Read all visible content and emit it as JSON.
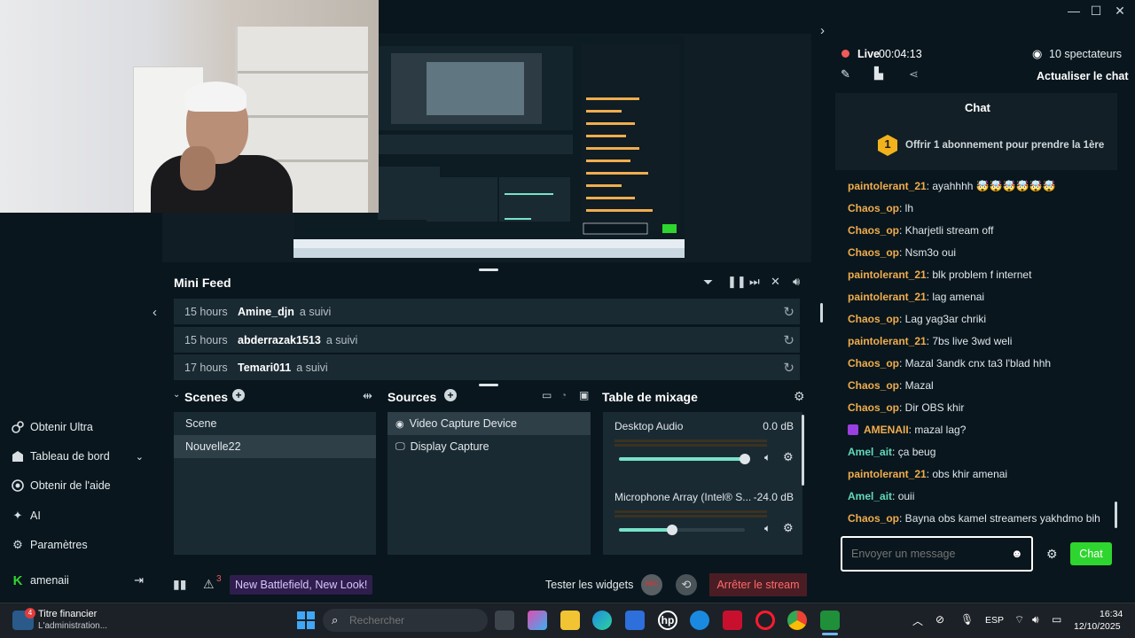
{
  "window": {
    "minimize": "—",
    "maximize": "☐",
    "close": "✕",
    "collapse": "›"
  },
  "colors": {
    "accent": "#80f5d2",
    "live_red": "#f05a5a",
    "chat_button": "#2fd52f",
    "orange_user": "#f0ad4e",
    "green_user": "#63d8b9",
    "badge": "#2f3bd4"
  },
  "nav": {
    "items": [
      {
        "label": "Obtenir Ultra",
        "icon": "ultra-icon"
      },
      {
        "label": "Tableau de bord",
        "icon": "dashboard-icon"
      },
      {
        "label": "Obtenir de l'aide",
        "icon": "help-icon"
      },
      {
        "label": "AI",
        "icon": "sparkle-icon"
      },
      {
        "label": "Paramètres",
        "icon": "gear-icon"
      }
    ],
    "user": "amenaii",
    "collapse_arrow": "‹"
  },
  "minifeed": {
    "title": "Mini Feed",
    "rows": [
      {
        "time": "15 hours",
        "name": "Amine_djn",
        "action": "a suivi"
      },
      {
        "time": "15 hours",
        "name": "abderrazak1513",
        "action": "a suivi"
      },
      {
        "time": "17 hours",
        "name": "Temari011",
        "action": "a suivi"
      }
    ]
  },
  "scenes": {
    "title": "Scenes",
    "items": [
      "Scene",
      "Nouvelle22"
    ],
    "selected": 1
  },
  "sources": {
    "title": "Sources",
    "items": [
      "Video Capture Device",
      "Display Capture"
    ],
    "selected": 0
  },
  "mixer": {
    "title": "Table de mixage",
    "channels": [
      {
        "name": "Desktop Audio",
        "level": "0.0 dB",
        "volume": 1.0
      },
      {
        "name": "Microphone Array (Intel® S...",
        "level": "-24.0 dB",
        "volume": 0.42
      }
    ]
  },
  "bottombar": {
    "alerts_count": "3",
    "promo": "New Battlefield, New Look!",
    "test_widgets": "Tester les widgets",
    "rec": "REC",
    "stop_stream": "Arrêter le stream"
  },
  "live": {
    "label": "Live",
    "timer": "00:04:13",
    "viewers": "10 spectateurs",
    "refresh_chat": "Actualiser le chat"
  },
  "chat": {
    "title": "Chat",
    "sub_badge": "1",
    "sub_offer": "Offrir 1 abonnement pour prendre la 1ère",
    "messages": [
      {
        "user": "paintolerant_21",
        "text": ": ayahhhh 🤯🤯🤯🤯🤯🤯",
        "color": "orange"
      },
      {
        "user": "Chaos_op",
        "text": ": lh",
        "color": "orange"
      },
      {
        "user": "Chaos_op",
        "text": ": Kharjetli stream off",
        "color": "orange"
      },
      {
        "user": "Chaos_op",
        "text": ": Nsm3o oui",
        "color": "orange"
      },
      {
        "user": "paintolerant_21",
        "text": ": blk problem f internet",
        "color": "orange"
      },
      {
        "user": "paintolerant_21",
        "text": ": lag amenai",
        "color": "orange"
      },
      {
        "user": "Chaos_op",
        "text": ": Lag yag3ar chriki",
        "color": "orange"
      },
      {
        "user": "paintolerant_21",
        "text": ": 7bs live 3wd weli",
        "color": "orange"
      },
      {
        "user": "Chaos_op",
        "text": ": Mazal 3andk cnx ta3 l'blad hhh",
        "color": "orange"
      },
      {
        "user": "Chaos_op",
        "text": ": Mazal",
        "color": "orange"
      },
      {
        "user": "Chaos_op",
        "text": ": Dir OBS khir",
        "color": "orange"
      },
      {
        "user": "AMENAII",
        "text": ": mazal lag?",
        "color": "orange",
        "streamer": true
      },
      {
        "user": "Amel_ait",
        "text": ": ça beug",
        "color": "green"
      },
      {
        "user": "paintolerant_21",
        "text": ": obs khir amenai",
        "color": "orange"
      },
      {
        "user": "Amel_ait",
        "text": ": ouii",
        "color": "green"
      },
      {
        "user": "Chaos_op",
        "text": ": Bayna obs kamel streamers yakhdmo bih",
        "color": "orange"
      }
    ],
    "input_placeholder": "Envoyer un message",
    "send": "Chat"
  },
  "taskbar": {
    "news_badge": "4",
    "news_title": "Titre financier",
    "news_sub": "L'administration...",
    "search_placeholder": "Rechercher",
    "lang": "ESP",
    "time": "16:34",
    "date": "12/10/2025"
  }
}
